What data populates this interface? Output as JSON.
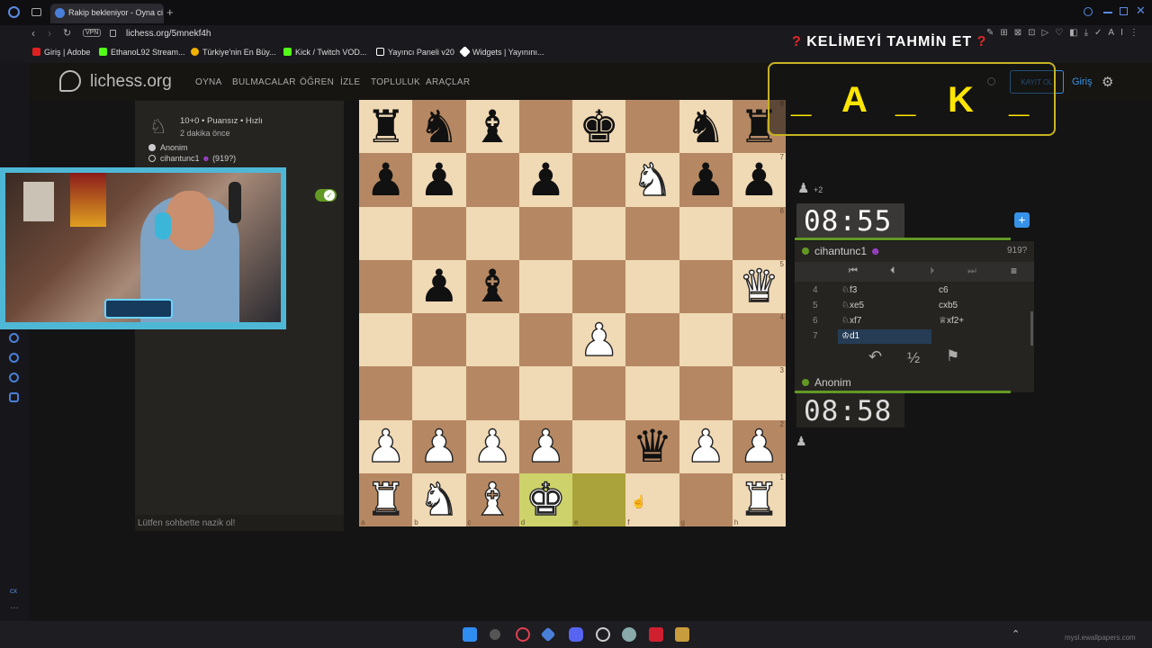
{
  "browser": {
    "tab_title": "Rakip bekleniyor - Oyna ci",
    "vpn_label": "VPN",
    "url": "lichess.org/5mnekf4h",
    "bookmarks": [
      "Giriş | Adobe",
      "EthanoL92 Stream...",
      "Türkiye'nin En Büy...",
      "Kick / Twitch VOD...",
      "Yayıncı Paneli v20",
      "Widgets | Yayınını..."
    ],
    "bookmark_colors": [
      "#e02020",
      "#53fc18",
      "#f0b000",
      "#53fc18",
      "#ffffff",
      "#ffffff"
    ]
  },
  "lichess": {
    "logo_text": "lichess.org",
    "nav": [
      "OYNA",
      "BULMACALAR",
      "ÖĞREN",
      "İZLE",
      "TOPLULUK",
      "ARAÇLAR"
    ],
    "signup": "KAYIT OL",
    "login": "Giriş"
  },
  "game_info": {
    "mode": "10+0 • Puansız • Hızlı",
    "time_ago": "2 dakika önce",
    "player_white": "Anonim",
    "player_black": "cihantunc1",
    "player_black_rating": "(919?)"
  },
  "chat": {
    "placeholder": "Lütfen sohbette nazik ol!"
  },
  "board": {
    "ranks": [
      [
        "br",
        "bn",
        "bb",
        "",
        "bk",
        "",
        "bn",
        "br"
      ],
      [
        "bp",
        "bp",
        "",
        "bp",
        "",
        "wn",
        "bp",
        "bp"
      ],
      [
        "",
        "",
        "",
        "",
        "",
        "",
        "",
        ""
      ],
      [
        "",
        "bp",
        "bb",
        "",
        "",
        "",
        "",
        "wq"
      ],
      [
        "",
        "",
        "",
        "",
        "wp",
        "",
        "",
        ""
      ],
      [
        "",
        "",
        "",
        "",
        "",
        "",
        "",
        ""
      ],
      [
        "wp",
        "wp",
        "wp",
        "wp",
        "",
        "bq",
        "wp",
        "wp"
      ],
      [
        "wr",
        "wn",
        "wb",
        "wk",
        "",
        "",
        "",
        "wr"
      ]
    ],
    "highlight_squares": [
      "d1",
      "e1"
    ],
    "files": [
      "a",
      "b",
      "c",
      "d",
      "e",
      "f",
      "g",
      "h"
    ],
    "rank_labels": [
      "8",
      "7",
      "6",
      "5",
      "4",
      "3",
      "2",
      "1"
    ]
  },
  "right_panel": {
    "material": "+2",
    "top_clock": "08:55",
    "top_player": "cihantunc1",
    "top_rating": "919?",
    "bottom_clock": "08:58",
    "bottom_player": "Anonim",
    "moves": [
      {
        "n": "4",
        "w": "♘f3",
        "b": "c6"
      },
      {
        "n": "5",
        "w": "♘xe5",
        "b": "cxb5"
      },
      {
        "n": "6",
        "w": "♘xf7",
        "b": "♕xf2+"
      },
      {
        "n": "7",
        "w": "♔d1",
        "b": ""
      }
    ],
    "actions": [
      "↶",
      "½",
      "⚑"
    ]
  },
  "overlay": {
    "title": "KELİMEYİ TAHMİN ET",
    "letters": [
      "_",
      "A",
      "_",
      "K",
      "_"
    ]
  },
  "colors": {
    "accent": "#629924",
    "board_light": "#f0d9b5",
    "board_dark": "#b58863",
    "overlay_yellow": "#ffe600"
  },
  "watermark": "mysl.ewallpapers.com"
}
